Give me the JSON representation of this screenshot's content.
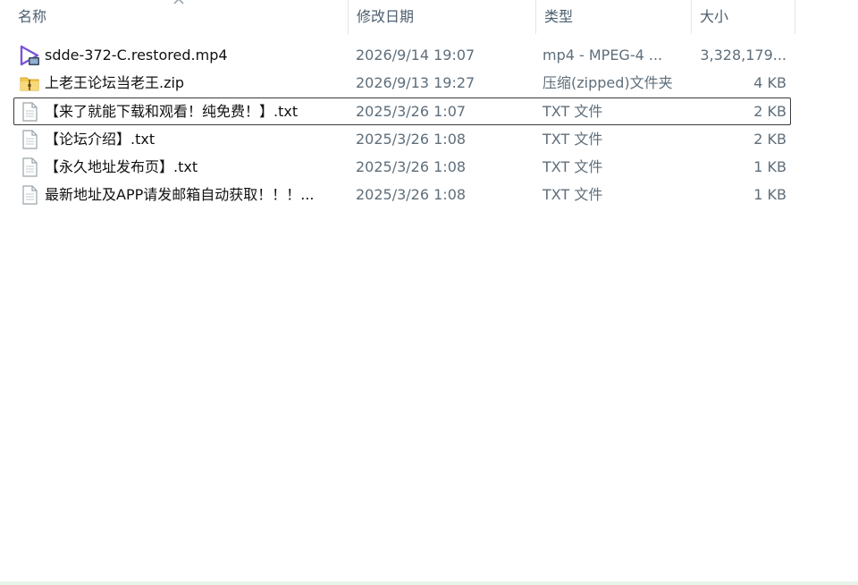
{
  "columns": {
    "name": "名称",
    "date": "修改日期",
    "type": "类型",
    "size": "大小"
  },
  "files": [
    {
      "name": "sdde-372-C.restored.mp4",
      "date": "2026/9/14 19:07",
      "type": "mp4 - MPEG-4 ...",
      "size": "3,328,179...",
      "icon": "video-file-icon"
    },
    {
      "name": "上老王论坛当老王.zip",
      "date": "2026/9/13 19:27",
      "type": "压缩(zipped)文件夹",
      "size": "4 KB",
      "icon": "zip-folder-icon"
    },
    {
      "name": "【来了就能下载和观看！纯免费！】.txt",
      "date": "2025/3/26 1:07",
      "type": "TXT 文件",
      "size": "2 KB",
      "icon": "text-file-icon"
    },
    {
      "name": "【论坛介绍】.txt",
      "date": "2025/3/26 1:08",
      "type": "TXT 文件",
      "size": "2 KB",
      "icon": "text-file-icon"
    },
    {
      "name": "【永久地址发布页】.txt",
      "date": "2025/3/26 1:08",
      "type": "TXT 文件",
      "size": "1 KB",
      "icon": "text-file-icon"
    },
    {
      "name": "最新地址及APP请发邮箱自动获取！！！...",
      "date": "2025/3/26 1:08",
      "type": "TXT 文件",
      "size": "1 KB",
      "icon": "text-file-icon"
    }
  ],
  "colors": {
    "header_text": "#4c5f6f",
    "name_text": "#111111",
    "meta_text": "#5e6e7b",
    "focus_border": "#3a3a3a",
    "video_icon": "#7a55d6",
    "zip_icon": "#f2c94c"
  }
}
